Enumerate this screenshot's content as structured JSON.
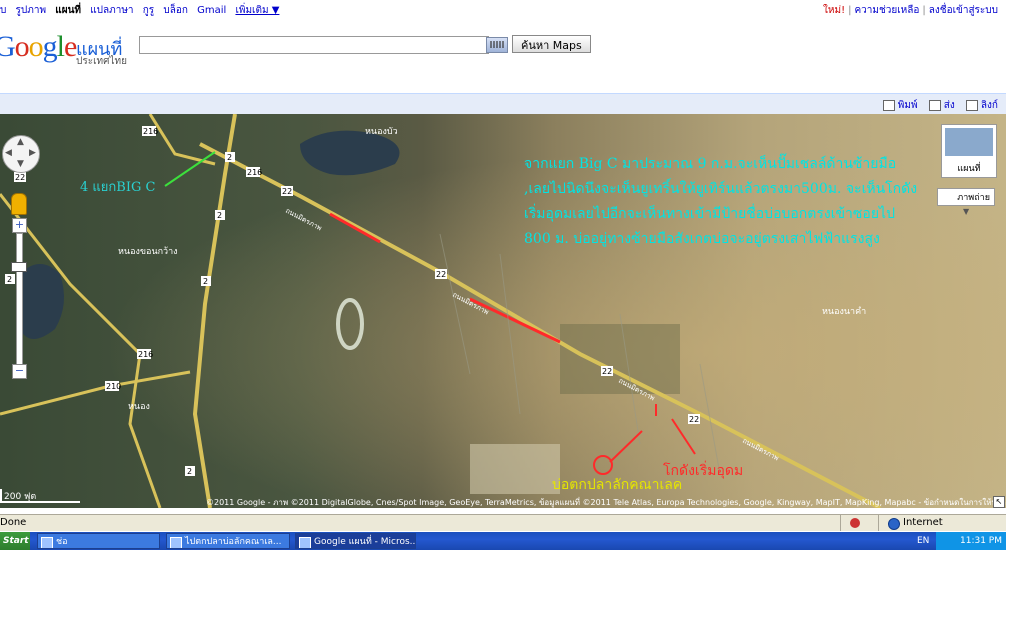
{
  "gbar": {
    "links": [
      "บ",
      "รูปภาพ",
      "แผนที่",
      "แปลภาษา",
      "กูรู",
      "บล็อก",
      "Gmail",
      "เพิ่มเติม ▼"
    ],
    "right": {
      "new_label": "ใหม่!",
      "help": "ความช่วยเหลือ",
      "signin": "ลงชื่อเข้าสู่ระบบ"
    }
  },
  "header": {
    "logo_text": "Google",
    "maps_label": "แผนที่",
    "country_label": "ประเทศไทย",
    "search_value": "",
    "search_button": "ค้นหา Maps"
  },
  "toolbar": {
    "print": "พิมพ์",
    "send": "ส่ง",
    "link": "ลิงก์"
  },
  "map": {
    "annotations": {
      "note": "จากแยก Big C มาประมาณ 9 ก.ม.จะเห็นปั๊มเชลล์ด้านซ้ายมือ ,เลยไปนิดนึงจะเห็นยูเทริ์นให้ยูเทิร์นแล้วตรงมา500ม. จะเห็นโกดังเริ่มอุดมเลยไปอีกจะเห็นทางเข้ามีป้ายชื่อบ่อบอกตรงเข้าซอยไป 800 ม. บ่ออยู่ทางซ้ายมือสังเกตบ่อจะอยู่ตรงเสาไฟฟ้าแรงสูง",
      "bigc": "4 แยกBIG C",
      "warehouse": "โกดังเริ่มอุดม",
      "pond": "บ่อตกปลาลักคณาเลค"
    },
    "road_shields": [
      "216",
      "2",
      "216",
      "22",
      "2",
      "22",
      "2",
      "210",
      "22",
      "2",
      "216",
      "22",
      "22",
      "2"
    ],
    "road_name": "ถนนมิตรภาพ",
    "places": [
      "หนองบัว",
      "หนองขอนกว้าง",
      "หนองนาคำ",
      "หนอง"
    ],
    "overview_label": "แผนที่",
    "type_select": "ภาพถ่าย",
    "scale_label": "200 ฟุต",
    "copyright": "©2011 Google - ภาพ ©2011 DigitalGlobe, Cnes/Spot Image, GeoEye, TerraMetrics, ข้อมูลแผนที่ ©2011 Tele Atlas, Europa Technologies, Google, Kingway, MapIT, MapKing, Mapabc - ข้อกำหนดในการให้บริการ"
  },
  "statusbar": {
    "text": "Done",
    "zone": "Internet"
  },
  "taskbar": {
    "start": "Start",
    "tasks": [
      "ช่อ",
      "ไปตกปลาบ่อลักคณาเล...",
      "Google แผนที่ - Micros..."
    ],
    "lang": "EN",
    "clock": "11:31 PM"
  },
  "colors": {
    "note": "#00e4e4",
    "warehouse": "#ff2a2a",
    "pond": "#e6e600",
    "road": "#d8c25a"
  }
}
